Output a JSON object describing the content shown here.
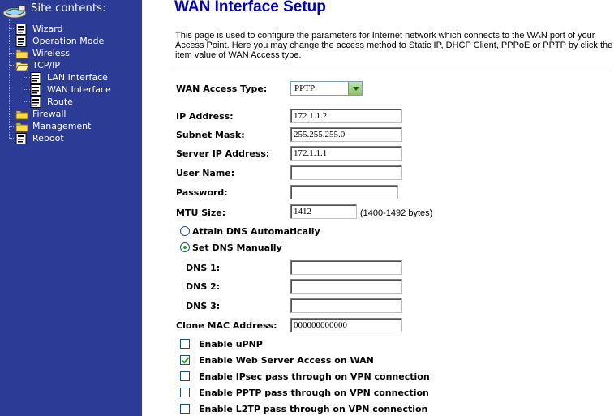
{
  "sidebar": {
    "title": "Site contents:",
    "items": {
      "wizard": "Wizard",
      "operation_mode": "Operation Mode",
      "wireless": "Wireless",
      "tcpip": "TCP/IP",
      "lan_interface": "LAN Interface",
      "wan_interface": "WAN Interface",
      "route": "Route",
      "firewall": "Firewall",
      "management": "Management",
      "reboot": "Reboot"
    }
  },
  "main": {
    "title": "WAN Interface Setup",
    "description": "This page is used to configure the parameters for Internet network which connects to the WAN port of your Access Point. Here you may change the access method to Static IP, DHCP Client, PPPoE or PPTP by click the item value of WAN Access type.",
    "wan_access_type": {
      "label": "WAN Access Type:",
      "value": "PPTP"
    },
    "ip_address": {
      "label": "IP Address:",
      "value": "172.1.1.2"
    },
    "subnet_mask": {
      "label": "Subnet Mask:",
      "value": "255.255.255.0"
    },
    "server_ip": {
      "label": "Server IP Address:",
      "value": "172.1.1.1"
    },
    "user_name": {
      "label": "User Name:",
      "value": ""
    },
    "password": {
      "label": "Password:",
      "value": ""
    },
    "mtu": {
      "label": "MTU Size:",
      "value": "1412",
      "hint": "(1400-1492 bytes)"
    },
    "dns_auto": {
      "label": "Attain DNS Automatically",
      "selected": false
    },
    "dns_manual": {
      "label": "Set DNS Manually",
      "selected": true
    },
    "dns1": {
      "label": "DNS 1:",
      "value": ""
    },
    "dns2": {
      "label": "DNS 2:",
      "value": ""
    },
    "dns3": {
      "label": "DNS 3:",
      "value": ""
    },
    "clone_mac": {
      "label": "Clone MAC Address:",
      "value": "000000000000"
    },
    "checkboxes": {
      "upnp": {
        "label": "Enable uPNP",
        "checked": false
      },
      "web_access": {
        "label": "Enable Web Server Access on WAN",
        "checked": true
      },
      "ipsec": {
        "label": "Enable IPsec pass through on VPN connection",
        "checked": false
      },
      "pptp": {
        "label": "Enable PPTP pass through on VPN connection",
        "checked": false
      },
      "l2tp": {
        "label": "Enable L2TP pass through on VPN connection",
        "checked": false
      }
    }
  },
  "colors": {
    "sidebar_bg": "#2c3c96",
    "title_blue": "#0000b4",
    "check_green": "#21a121"
  },
  "icons": {
    "header": "globe-computer-icon",
    "page": "document-page-icon",
    "folder": "folder-icon"
  }
}
